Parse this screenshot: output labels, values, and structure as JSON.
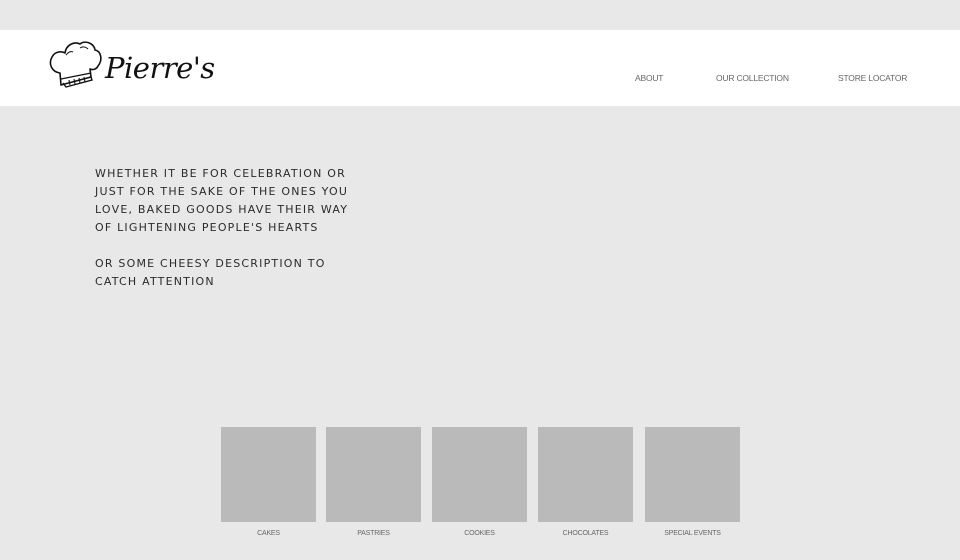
{
  "header": {
    "brand": "Pierre's",
    "logo_icon": "chef-hat-icon"
  },
  "nav": {
    "items": [
      {
        "label": "ABOUT"
      },
      {
        "label": "OUR COLLECTION"
      },
      {
        "label": "STORE LOCATOR"
      }
    ]
  },
  "hero": {
    "paragraph_1": "WHETHER IT BE FOR CELEBRATION OR JUST FOR THE SAKE OF THE ONES YOU LOVE, BAKED GOODS HAVE THEIR WAY OF LIGHTENING PEOPLE'S HEARTS",
    "paragraph_2": "OR SOME CHEESY DESCRIPTION TO CATCH ATTENTION"
  },
  "categories": [
    {
      "label": "CAKES"
    },
    {
      "label": "PASTRIES"
    },
    {
      "label": "COOKIES"
    },
    {
      "label": "CHOCOLATES"
    },
    {
      "label": "SPECIAL EVENTS"
    }
  ],
  "colors": {
    "page_background": "#e8e8e8",
    "header_background": "#ffffff",
    "tile_placeholder": "#bababa",
    "nav_text": "#666666"
  }
}
